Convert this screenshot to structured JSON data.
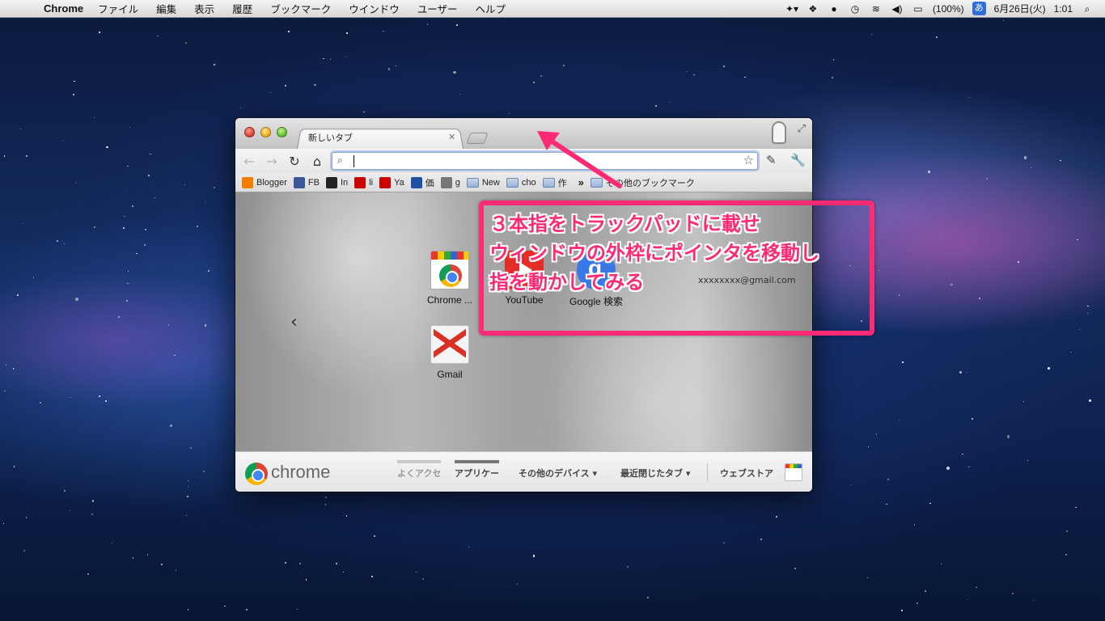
{
  "menubar": {
    "app_name": "Chrome",
    "items": [
      "ファイル",
      "編集",
      "表示",
      "履歴",
      "ブックマーク",
      "ウインドウ",
      "ユーザー",
      "ヘルプ"
    ],
    "battery": "(100%)",
    "ime": "あ",
    "date": "6月26日(火)",
    "time": "1:01"
  },
  "browser": {
    "tab_title": "新しいタブ",
    "omnibox_value": "",
    "bookmarks": [
      {
        "label": "Blogger",
        "icon": "blogger-icon",
        "color": "#f57d00"
      },
      {
        "label": "FB",
        "icon": "facebook-icon",
        "color": "#3b5998"
      },
      {
        "label": "In",
        "icon": "instapaper-icon",
        "color": "#222222"
      },
      {
        "label": "li",
        "icon": "livedoor-icon",
        "color": "#cc0000"
      },
      {
        "label": "Ya",
        "icon": "yahoo-icon",
        "color": "#cc0000"
      },
      {
        "label": "価",
        "icon": "kakaku-icon",
        "color": "#1f4fa0"
      },
      {
        "label": "g",
        "icon": "globe-icon",
        "color": "#777777"
      },
      {
        "label": "New",
        "icon": "folder-icon",
        "color": "#96b1d6"
      },
      {
        "label": "cho",
        "icon": "folder-icon",
        "color": "#96b1d6"
      },
      {
        "label": "作",
        "icon": "folder-icon",
        "color": "#96b1d6"
      }
    ],
    "bookmarks_overflow": "»",
    "other_bookmarks": "その他のブックマーク",
    "email_partial": "xxxxxxxx@gmail.com",
    "apps": [
      {
        "label": "Chrome ...",
        "name": "app-chrome-web-store"
      },
      {
        "label": "YouTube",
        "name": "app-youtube"
      },
      {
        "label": "Google 検索",
        "name": "app-google-search"
      },
      {
        "label": "Gmail",
        "name": "app-gmail"
      }
    ],
    "footer": {
      "brand": "chrome",
      "tabs": [
        "よくアクセ",
        "アプリケー",
        "その他のデバイス ▾",
        "最近閉じたタブ ▾"
      ],
      "store": "ウェブストア"
    }
  },
  "annotation": {
    "lines": [
      "３本指をトラックパッドに載せ",
      "ウィンドウの外枠にポインタを移動し",
      "指を動かしてみる"
    ],
    "color": "#ff2a74"
  }
}
